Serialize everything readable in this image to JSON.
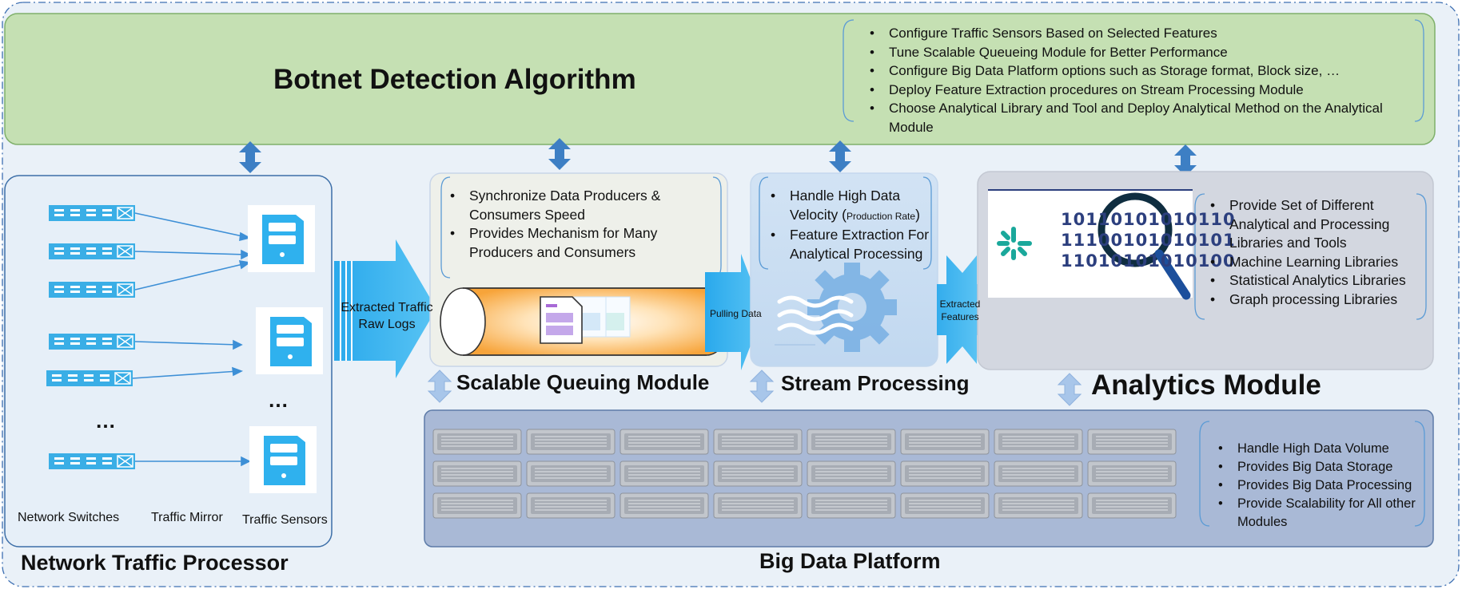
{
  "algorithm": {
    "title": "Botnet Detection Algorithm",
    "bullets": [
      "Configure Traffic Sensors Based on Selected Features",
      "Tune Scalable Queueing Module for Better Performance",
      "Configure Big Data Platform options such as Storage format, Block size, …",
      "Deploy Feature Extraction procedures on Stream Processing Module",
      "Choose Analytical Library and Tool and Deploy Analytical Method on the Analytical Module"
    ]
  },
  "network": {
    "title": "Network Traffic Processor",
    "ellipsis": "…",
    "sensor_ellipsis": "…",
    "labels": {
      "switches": "Network Switches",
      "mirror": "Traffic Mirror",
      "sensors": "Traffic Sensors"
    },
    "arrow_label": "Extracted Traffic Raw Logs"
  },
  "queuing": {
    "title": "Scalable Queuing Module",
    "bullets": [
      "Synchronize Data Producers & Consumers Speed",
      "Provides Mechanism for Many Producers and Consumers"
    ],
    "arrow_label": "Pulling Data"
  },
  "stream": {
    "title": "Stream Processing",
    "bullet1_main": "Handle High Data Velocity (",
    "bullet1_small": "Production Rate",
    "bullet1_end": ")",
    "bullet2": "Feature Extraction For Analytical Processing",
    "arrow_label": "Extracted Features"
  },
  "analytics": {
    "title": "Analytics Module",
    "binary": [
      "10110101010110",
      "11100101010101",
      "11010101010100"
    ],
    "bullets": [
      "Provide Set of Different Analytical and Processing Libraries and Tools",
      "Machine Learning Libraries",
      " Statistical Analytics Libraries",
      "Graph processing Libraries"
    ]
  },
  "bigdata": {
    "title": "Big Data Platform",
    "bullets": [
      "Handle High Data Volume",
      "Provides Big Data Storage",
      "Provides Big Data Processing",
      "Provide Scalability for All other Modules"
    ]
  },
  "colors": {
    "header_green": "#c5e0b3",
    "panel_blue": "#e6eff8",
    "accent_blue": "#4ab8ee",
    "storage_panel": "#a9b9d6",
    "analytics_panel": "#d3d7e0"
  }
}
